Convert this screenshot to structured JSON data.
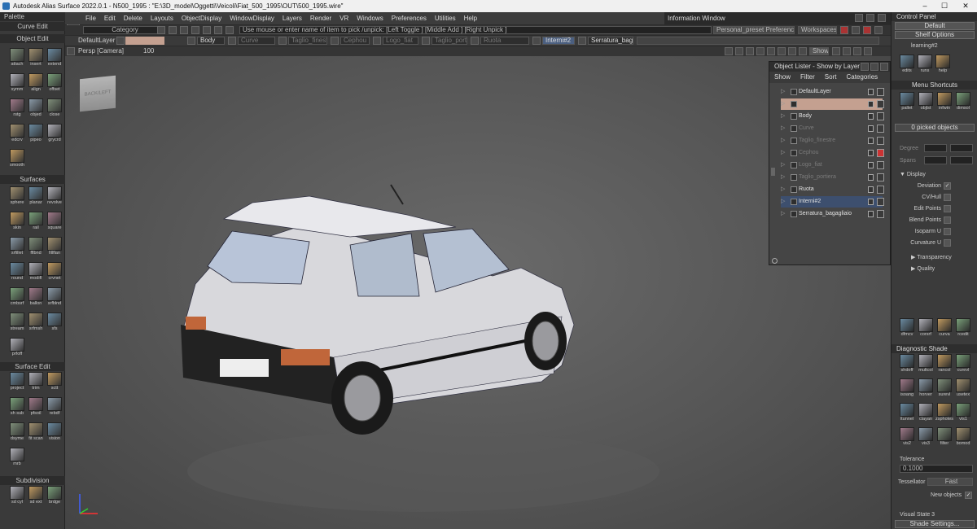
{
  "title_bar": {
    "title": "Autodesk Alias Surface 2022.0.1   - N500_1995 : \"E:\\3D_model\\Oggetti\\Veicoli\\Fiat_500_1995\\OUT\\500_1995.wire\"",
    "minimize": "–",
    "maximize": "☐",
    "close": "✕"
  },
  "menu": [
    "File",
    "Edit",
    "Delete",
    "Layouts",
    "ObjectDisplay",
    "WindowDisplay",
    "Layers",
    "Render",
    "VR",
    "Windows",
    "Preferences",
    "Utilities",
    "Help"
  ],
  "info_window": {
    "title": "Information Window"
  },
  "toolbar": {
    "app_label": "surf",
    "category": "Category",
    "prompt": "Use mouse or enter name of item to pick /unpick: [Left Toggle ] [Middle Add ] [Right Unpick ]",
    "preset_prefs": "Personal_preset Preferences",
    "workspaces": "Workspaces",
    "layer_default": "DefaultLayer",
    "layers": [
      "Body",
      "Curve",
      "Taglio_finestre",
      "Cephou",
      "Logo_fiat",
      "Taglio_portiere",
      "Ruota",
      "Interni#2",
      "Serratura_baga"
    ],
    "viewport_label": "Persp [Camera]",
    "zoom": "100",
    "show_button": "Show"
  },
  "palette": {
    "title": "Palette",
    "sections": [
      {
        "name": "Curve Edit",
        "tools": []
      },
      {
        "name": "Object Edit",
        "tools": [
          "attach",
          "insert",
          "extend",
          "symm",
          "align",
          "offset",
          "rstg",
          "objed",
          "close",
          "edcrv",
          "pipeo",
          "grycrd",
          "smooth"
        ]
      },
      {
        "name": "Surfaces",
        "tools": [
          "sphere",
          "planar",
          "revolve",
          "skin",
          "rail",
          "square",
          "srfillet",
          "fflbnd",
          "fillflan",
          "round",
          "modifl",
          "crvnet",
          "cmbsrf",
          "ballon",
          "srfblnd",
          "stream",
          "srfmsh",
          "sfs",
          "prfoff"
        ]
      },
      {
        "name": "Surface Edit",
        "tools": [
          "project",
          "trim",
          "sctt",
          "sh sub",
          "pfsoil",
          "rebdf",
          "dsyme",
          "fit scan",
          "vision",
          "mrb"
        ]
      },
      {
        "name": "Subdivision",
        "tools": [
          "sd cyl",
          "sd ext",
          "brdge"
        ]
      }
    ]
  },
  "object_lister": {
    "title": "Object Lister - Show by Layer",
    "tabs": [
      "Show",
      "Filter",
      "Sort",
      "Categories"
    ],
    "items": [
      {
        "name": "DefaultLayer",
        "state": "normal"
      },
      {
        "name": "",
        "state": "selected"
      },
      {
        "name": "Body",
        "state": "normal"
      },
      {
        "name": "Curve",
        "state": "dim"
      },
      {
        "name": "Taglio_finestre",
        "state": "dim"
      },
      {
        "name": "Cephou",
        "state": "dim"
      },
      {
        "name": "Logo_fiat",
        "state": "dim"
      },
      {
        "name": "Taglio_portiera",
        "state": "dim"
      },
      {
        "name": "Ruota",
        "state": "normal"
      },
      {
        "name": "Interni#2",
        "state": "active"
      },
      {
        "name": "Serratura_bagagliaio",
        "state": "normal"
      }
    ]
  },
  "control_panel": {
    "title": "Control Panel",
    "default": "Default",
    "shelf_options": "Shelf Options",
    "shelf_name": "learning#2",
    "shelf_tools": [
      "edits",
      "runs",
      "help"
    ],
    "menu_shortcuts": "Menu Shortcuts",
    "shortcut_tools": [
      "pallet",
      "objlst",
      "infwin",
      "dimsol"
    ],
    "picked": "0 picked objects",
    "degree": "Degree",
    "spans": "Spans",
    "display_section": "Display",
    "display_options": [
      "Deviation",
      "CV/Hull",
      "Edit Points",
      "Blend Points",
      "Isoparm U",
      "Curvature U"
    ],
    "sub_sections": [
      "Transparency",
      "Quality"
    ],
    "bottom_tools": [
      "dfmcv",
      "corsrf",
      "curva",
      "rcedit"
    ],
    "diagnostic_shade": "Diagnostic Shade",
    "diag_tools": [
      "shdoff",
      "multcol",
      "rancol",
      "curevl",
      "isoang",
      "horver",
      "surevl",
      "usetex",
      "ltunnel",
      "clayan",
      "zsphotes",
      "vis1",
      "vis2",
      "vis3",
      "filter",
      "bomod"
    ],
    "tolerance_label": "Tolerance",
    "tolerance_value": "0.1000",
    "tessellator_label": "Tessellator",
    "tessellator_value": "Fast",
    "new_objects": "New objects",
    "visual_state": "Visual State 3",
    "shade_settings": "Shade Settings..."
  },
  "viewcube": {
    "label": "BACK/LEFT"
  },
  "colors": {
    "accent": "#c4a090",
    "viewport_center": "#6a6a6a",
    "car_body": "#d8d8dc"
  }
}
